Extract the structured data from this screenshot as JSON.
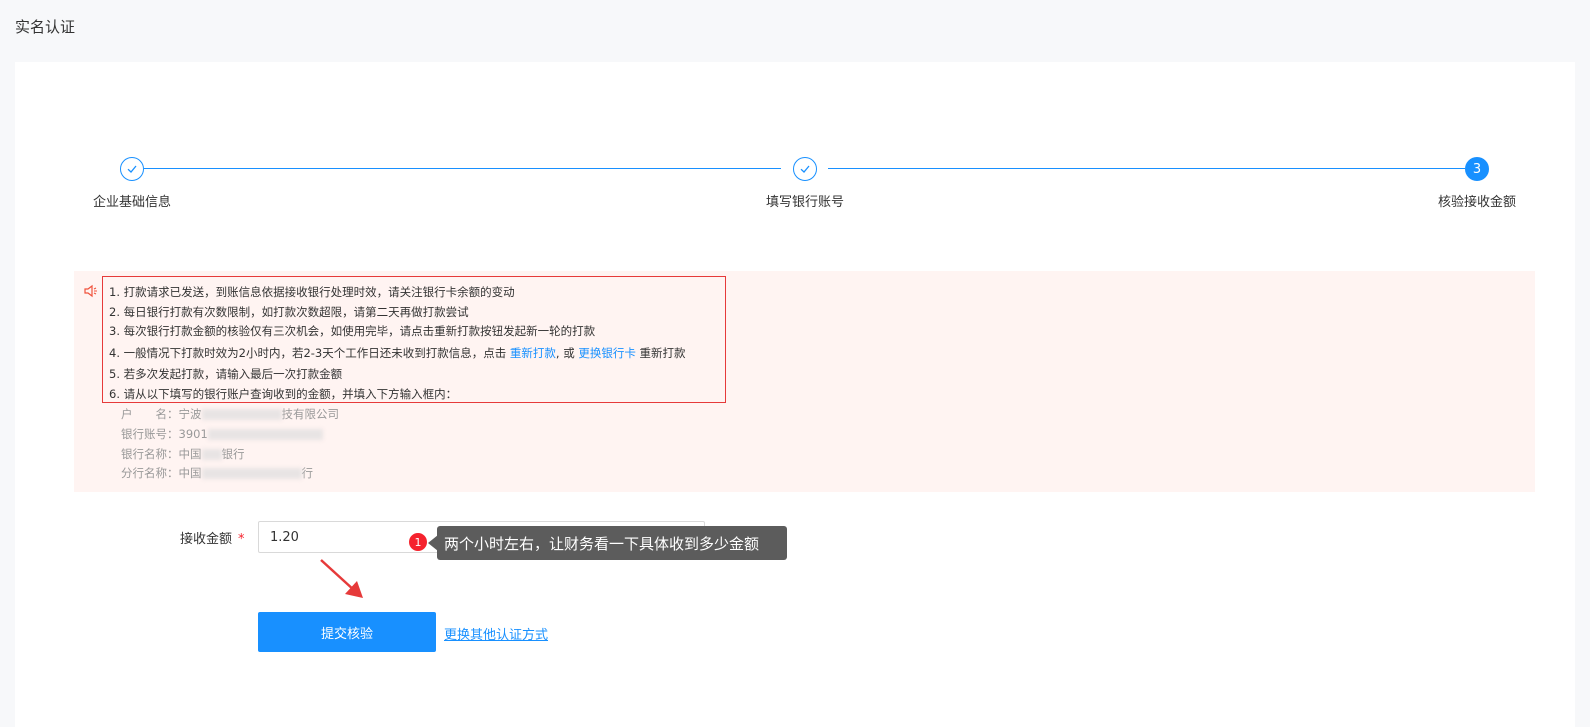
{
  "page": {
    "title": "实名认证"
  },
  "steps": [
    {
      "label": "企业基础信息",
      "status": "done",
      "icon": "check-icon"
    },
    {
      "label": "填写银行账号",
      "status": "done",
      "icon": "check-icon"
    },
    {
      "label": "核验接收金额",
      "status": "current",
      "number": "3"
    }
  ],
  "notice": {
    "icon": "speaker-icon",
    "lines": [
      "1. 打款请求已发送，到账信息依据接收银行处理时效，请关注银行卡余额的变动",
      "2. 每日银行打款有次数限制，如打款次数超限，请第二天再做打款尝试",
      "3. 每次银行打款金额的核验仅有三次机会，如使用完毕，请点击重新打款按钮发起新一轮的打款"
    ],
    "line4": {
      "prefix": "4. 一般情况下打款时效为2小时内，若2-3天个工作日还未收到打款信息，点击 ",
      "link1": "重新打款",
      "middle": ", 或 ",
      "link2": "更换银行卡",
      "suffix": " 重新打款"
    },
    "line5": "5. 若多次发起打款，请输入最后一次打款金额",
    "line6": "6. 请从以下填写的银行账户查询收到的金额，并填入下方输入框内：",
    "account": {
      "name_label": "户　　名：",
      "name_prefix": "宁波",
      "name_suffix": "技有限公司",
      "number_label": "银行账号：",
      "number_prefix": "3901",
      "bank_label": "银行名称：",
      "bank_prefix": "中国",
      "bank_suffix": "银行",
      "branch_label": "分行名称：",
      "branch_prefix": "中国",
      "branch_suffix": "行"
    }
  },
  "form": {
    "amount_label": "接收金额",
    "required_mark": "*",
    "amount_value": "1.20"
  },
  "tooltip": {
    "badge": "1",
    "text": "两个小时左右，让财务看一下具体收到多少金额"
  },
  "actions": {
    "submit_label": "提交核验",
    "alt_link": "更换其他认证方式"
  },
  "colors": {
    "primary": "#1890ff",
    "notice_bg": "#fff4f2",
    "annotation_red": "#e63a3a"
  }
}
